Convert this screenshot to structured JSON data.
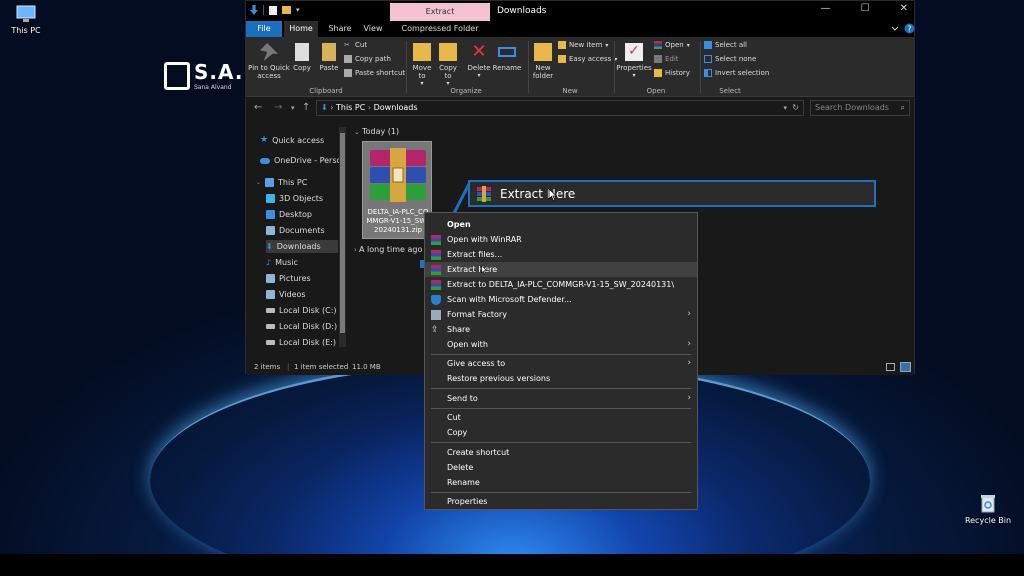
{
  "desktop": {
    "this_pc_label": "This PC",
    "recycle_bin_label": "Recycle Bin",
    "logo_text": "S.A.",
    "logo_sub": "Sana Alvand"
  },
  "window": {
    "title": "Downloads",
    "context_tab": "Extract",
    "tabs": [
      "File",
      "Home",
      "Share",
      "View",
      "Compressed Folder Tools"
    ],
    "minimize": "—",
    "maximize": "☐",
    "close": "✕"
  },
  "ribbon": {
    "clipboard": {
      "pin": "Pin to Quick access",
      "copy": "Copy",
      "paste": "Paste",
      "cut": "Cut",
      "copy_path": "Copy path",
      "paste_shortcut": "Paste shortcut",
      "group": "Clipboard"
    },
    "organize": {
      "move_to": "Move to",
      "copy_to": "Copy to",
      "delete": "Delete",
      "rename": "Rename",
      "group": "Organize"
    },
    "new": {
      "new_folder": "New folder",
      "new_item": "New item",
      "easy_access": "Easy access",
      "group": "New"
    },
    "open": {
      "properties": "Properties",
      "open": "Open",
      "edit": "Edit",
      "history": "History",
      "group": "Open"
    },
    "select": {
      "select_all": "Select all",
      "select_none": "Select none",
      "invert": "Invert selection",
      "group": "Select"
    }
  },
  "address": {
    "path_root": "This PC",
    "path_leaf": "Downloads",
    "search_placeholder": "Search Downloads"
  },
  "navpane": {
    "items": [
      {
        "label": "Quick access",
        "color": "#3b8fe0"
      },
      {
        "label": "OneDrive - Person",
        "color": "#3b8fe0"
      },
      {
        "label": "This PC",
        "color": "#5aa0e8"
      },
      {
        "label": "3D Objects",
        "color": "#39b6e8"
      },
      {
        "label": "Desktop",
        "color": "#3b8fe0"
      },
      {
        "label": "Documents",
        "color": "#8fb5d8"
      },
      {
        "label": "Downloads",
        "color": "#3b8fe0"
      },
      {
        "label": "Music",
        "color": "#3b8fe0"
      },
      {
        "label": "Pictures",
        "color": "#8fb5d8"
      },
      {
        "label": "Videos",
        "color": "#8fb5d8"
      },
      {
        "label": "Local Disk (C:)",
        "color": "#bbbbbb"
      },
      {
        "label": "Local Disk (D:)",
        "color": "#bbbbbb"
      },
      {
        "label": "Local Disk (E:)",
        "color": "#bbbbbb"
      }
    ]
  },
  "content": {
    "group_today": "Today (1)",
    "group_older": "A long time ago",
    "file_name": "DELTA_IA-PLC_COMMGR-V1-15_SW_20240131.zip"
  },
  "status": {
    "items": "2 items",
    "selected": "1 item selected",
    "size": "11.0 MB"
  },
  "callout": {
    "label": "Extract Here"
  },
  "context_menu": {
    "items": [
      {
        "label": "Open",
        "bold": true
      },
      {
        "label": "Open with WinRAR",
        "icon": "winrar-icon"
      },
      {
        "label": "Extract files...",
        "icon": "winrar-icon"
      },
      {
        "label": "Extract Here",
        "icon": "winrar-icon",
        "highlight": true
      },
      {
        "label": "Extract to DELTA_IA-PLC_COMMGR-V1-15_SW_20240131\\",
        "icon": "winrar-icon"
      },
      {
        "label": "Scan with Microsoft Defender...",
        "icon": "defender-shield-icon"
      },
      {
        "label": "Format Factory",
        "icon": "format-factory-icon",
        "submenu": true
      },
      {
        "label": "Share",
        "icon": "share-icon"
      },
      {
        "label": "Open with",
        "submenu": true
      },
      {
        "label": "Give access to",
        "submenu": true
      },
      {
        "label": "Restore previous versions"
      },
      {
        "label": "Send to",
        "submenu": true
      },
      {
        "label": "Cut"
      },
      {
        "label": "Copy"
      },
      {
        "label": "Create shortcut"
      },
      {
        "label": "Delete"
      },
      {
        "label": "Rename"
      },
      {
        "label": "Properties"
      }
    ]
  }
}
